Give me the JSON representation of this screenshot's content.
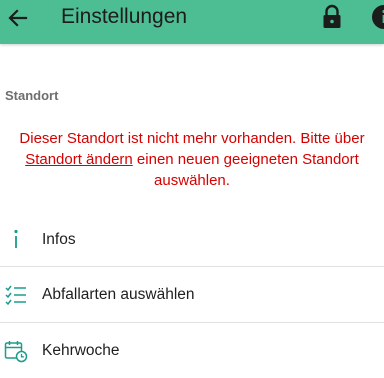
{
  "appbar": {
    "title": "Einstellungen",
    "back_icon": "arrow-back-icon",
    "lock_icon": "lock-icon",
    "info_icon": "info-icon",
    "background": "#4dbd93"
  },
  "location_section": {
    "header": "Standort",
    "warning_before": "Dieser Standort ist nicht mehr vorhanden. Bitte über ",
    "warning_link": "Standort ändern",
    "warning_after": " einen neuen geeigneten Standort auswählen.",
    "warning_color": "#d70000"
  },
  "menu_items": [
    {
      "label": "Infos",
      "icon": "info-letter-icon"
    },
    {
      "label": "Abfallarten auswählen",
      "icon": "checklist-icon"
    },
    {
      "label": "Kehrwoche",
      "icon": "calendar-clock-icon"
    }
  ],
  "accent": "#1a9c8c"
}
